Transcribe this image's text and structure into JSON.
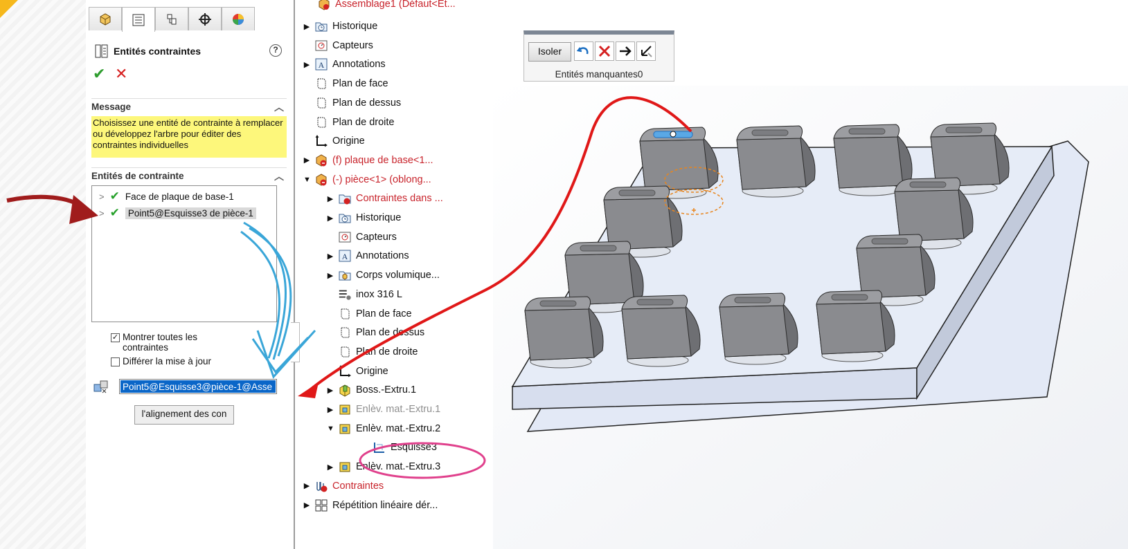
{
  "property_manager": {
    "title": "Entités contraintes",
    "help_label": "?",
    "message_section": "Message",
    "message_text": "Choisissez une entité de contrainte à remplacer ou développez l'arbre pour éditer des contraintes individuelles",
    "entities_section": "Entités de contrainte",
    "entities": [
      {
        "label": "Face de plaque de base-1",
        "selected": false
      },
      {
        "label": "Point5@Esquisse3 de pièce-1",
        "selected": true
      }
    ],
    "show_all_label": "Montrer toutes les contraintes",
    "show_all_checked": true,
    "defer_label": "Différer la mise à jour",
    "defer_checked": false,
    "selection_value": "Point5@Esquisse3@pièce-1@Asse",
    "align_button": "l'alignement des con"
  },
  "feature_tree": {
    "top_partial": "Assemblage1 (Défaut<Et...",
    "items": [
      {
        "label": "Historique",
        "expander": "right",
        "icon": "history-folder-icon",
        "color": "normal"
      },
      {
        "label": "Capteurs",
        "expander": "none",
        "icon": "sensor-icon",
        "color": "normal"
      },
      {
        "label": "Annotations",
        "expander": "right",
        "icon": "annotation-icon",
        "color": "normal"
      },
      {
        "label": "Plan de face",
        "expander": "none",
        "icon": "plane-icon",
        "color": "normal"
      },
      {
        "label": "Plan de dessus",
        "expander": "none",
        "icon": "plane-icon",
        "color": "normal"
      },
      {
        "label": "Plan de droite",
        "expander": "none",
        "icon": "plane-icon",
        "color": "normal"
      },
      {
        "label": "Origine",
        "expander": "none",
        "icon": "origin-icon",
        "color": "normal"
      },
      {
        "label": "(f) plaque de base<1...",
        "expander": "right",
        "icon": "part-icon",
        "color": "red"
      },
      {
        "label": "(-) pièce<1> (oblong...",
        "expander": "down",
        "icon": "part-icon",
        "color": "red"
      },
      {
        "label": "Contraintes dans ...",
        "expander": "right",
        "icon": "mates-folder-icon",
        "color": "red"
      },
      {
        "label": "Historique",
        "expander": "right",
        "icon": "history-folder-icon",
        "color": "normal"
      },
      {
        "label": "Capteurs",
        "expander": "none",
        "icon": "sensor-icon",
        "color": "normal"
      },
      {
        "label": "Annotations",
        "expander": "right",
        "icon": "annotation-icon",
        "color": "normal"
      },
      {
        "label": "Corps volumique...",
        "expander": "right",
        "icon": "solid-body-icon",
        "color": "normal"
      },
      {
        "label": "inox 316 L",
        "expander": "none",
        "icon": "material-icon",
        "color": "normal"
      },
      {
        "label": "Plan de face",
        "expander": "none",
        "icon": "plane-icon",
        "color": "normal"
      },
      {
        "label": "Plan de dessus",
        "expander": "none",
        "icon": "plane-icon",
        "color": "normal"
      },
      {
        "label": "Plan de droite",
        "expander": "none",
        "icon": "plane-icon",
        "color": "normal"
      },
      {
        "label": "Origine",
        "expander": "none",
        "icon": "origin-icon",
        "color": "normal"
      },
      {
        "label": "Boss.-Extru.1",
        "expander": "right",
        "icon": "extrude-icon",
        "color": "normal"
      },
      {
        "label": "Enlèv. mat.-Extru.1",
        "expander": "right",
        "icon": "cut-extrude-icon",
        "color": "gray"
      },
      {
        "label": "Enlèv. mat.-Extru.2",
        "expander": "down",
        "icon": "cut-extrude-icon",
        "color": "normal"
      },
      {
        "label": "Esquisse3",
        "expander": "none",
        "icon": "sketch-icon",
        "color": "normal"
      },
      {
        "label": "Enlèv. mat.-Extru.3",
        "expander": "right",
        "icon": "cut-extrude-icon",
        "color": "normal"
      },
      {
        "label": "Contraintes",
        "expander": "right",
        "icon": "mates-icon",
        "color": "red"
      },
      {
        "label": "Répétition linéaire dér...",
        "expander": "right",
        "icon": "pattern-icon",
        "color": "normal"
      }
    ]
  },
  "isolate_toolbar": {
    "isolate_button": "Isoler",
    "missing_label": "Entités manquantes0"
  },
  "colors": {
    "accent_blue": "#0a66c8",
    "message_yellow": "#fdf77b",
    "error_red": "#c8232b",
    "annotation_red": "#e01818",
    "annotation_blue": "#3aa6d8",
    "annotation_pink": "#e0408c"
  }
}
